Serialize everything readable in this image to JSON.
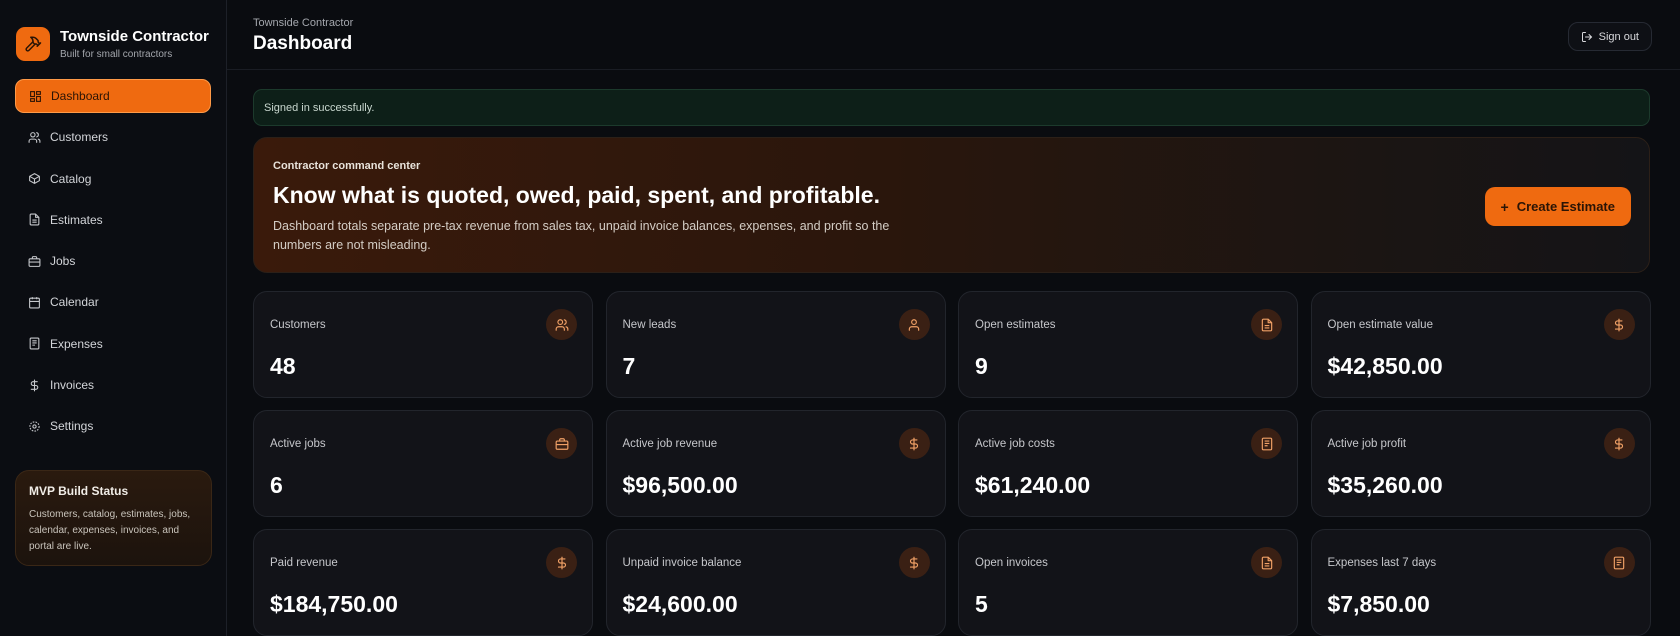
{
  "brand": {
    "name": "Townside Contractor",
    "tagline": "Built for small contractors",
    "logo_icon": "hammer-icon"
  },
  "colors": {
    "accent": "#ef6a10",
    "success_bg": "#0d1f18",
    "card_bg": "#121318"
  },
  "sidebar": {
    "items": [
      {
        "label": "Dashboard",
        "icon": "dashboard-icon",
        "active": true
      },
      {
        "label": "Customers",
        "icon": "users-icon"
      },
      {
        "label": "Catalog",
        "icon": "package-icon"
      },
      {
        "label": "Estimates",
        "icon": "file-text-icon"
      },
      {
        "label": "Jobs",
        "icon": "briefcase-icon"
      },
      {
        "label": "Calendar",
        "icon": "calendar-icon"
      },
      {
        "label": "Expenses",
        "icon": "receipt-icon"
      },
      {
        "label": "Invoices",
        "icon": "dollar-icon"
      },
      {
        "label": "Settings",
        "icon": "gear-icon"
      }
    ],
    "status_card": {
      "title": "MVP Build Status",
      "text": "Customers, catalog, estimates, jobs, calendar, expenses, invoices, and portal are live."
    }
  },
  "header": {
    "breadcrumb": "Townside Contractor",
    "title": "Dashboard",
    "signout_label": "Sign out"
  },
  "flash": {
    "message": "Signed in successfully."
  },
  "hero": {
    "eyebrow": "Contractor command center",
    "title": "Know what is quoted, owed, paid, spent, and profitable.",
    "description": "Dashboard totals separate pre-tax revenue from sales tax, unpaid invoice balances, expenses, and profit so the numbers are not misleading.",
    "cta_icon": "+",
    "cta_label": "Create Estimate"
  },
  "stats": [
    {
      "label": "Customers",
      "value": "48",
      "icon": "users-icon"
    },
    {
      "label": "New leads",
      "value": "7",
      "icon": "user-icon"
    },
    {
      "label": "Open estimates",
      "value": "9",
      "icon": "file-text-icon"
    },
    {
      "label": "Open estimate value",
      "value": "$42,850.00",
      "icon": "dollar-icon"
    },
    {
      "label": "Active jobs",
      "value": "6",
      "icon": "briefcase-icon"
    },
    {
      "label": "Active job revenue",
      "value": "$96,500.00",
      "icon": "dollar-icon"
    },
    {
      "label": "Active job costs",
      "value": "$61,240.00",
      "icon": "receipt-icon"
    },
    {
      "label": "Active job profit",
      "value": "$35,260.00",
      "icon": "dollar-icon"
    },
    {
      "label": "Paid revenue",
      "value": "$184,750.00",
      "icon": "dollar-icon"
    },
    {
      "label": "Unpaid invoice balance",
      "value": "$24,600.00",
      "icon": "dollar-icon"
    },
    {
      "label": "Open invoices",
      "value": "5",
      "icon": "file-text-icon"
    },
    {
      "label": "Expenses last 7 days",
      "value": "$7,850.00",
      "icon": "receipt-icon"
    }
  ]
}
